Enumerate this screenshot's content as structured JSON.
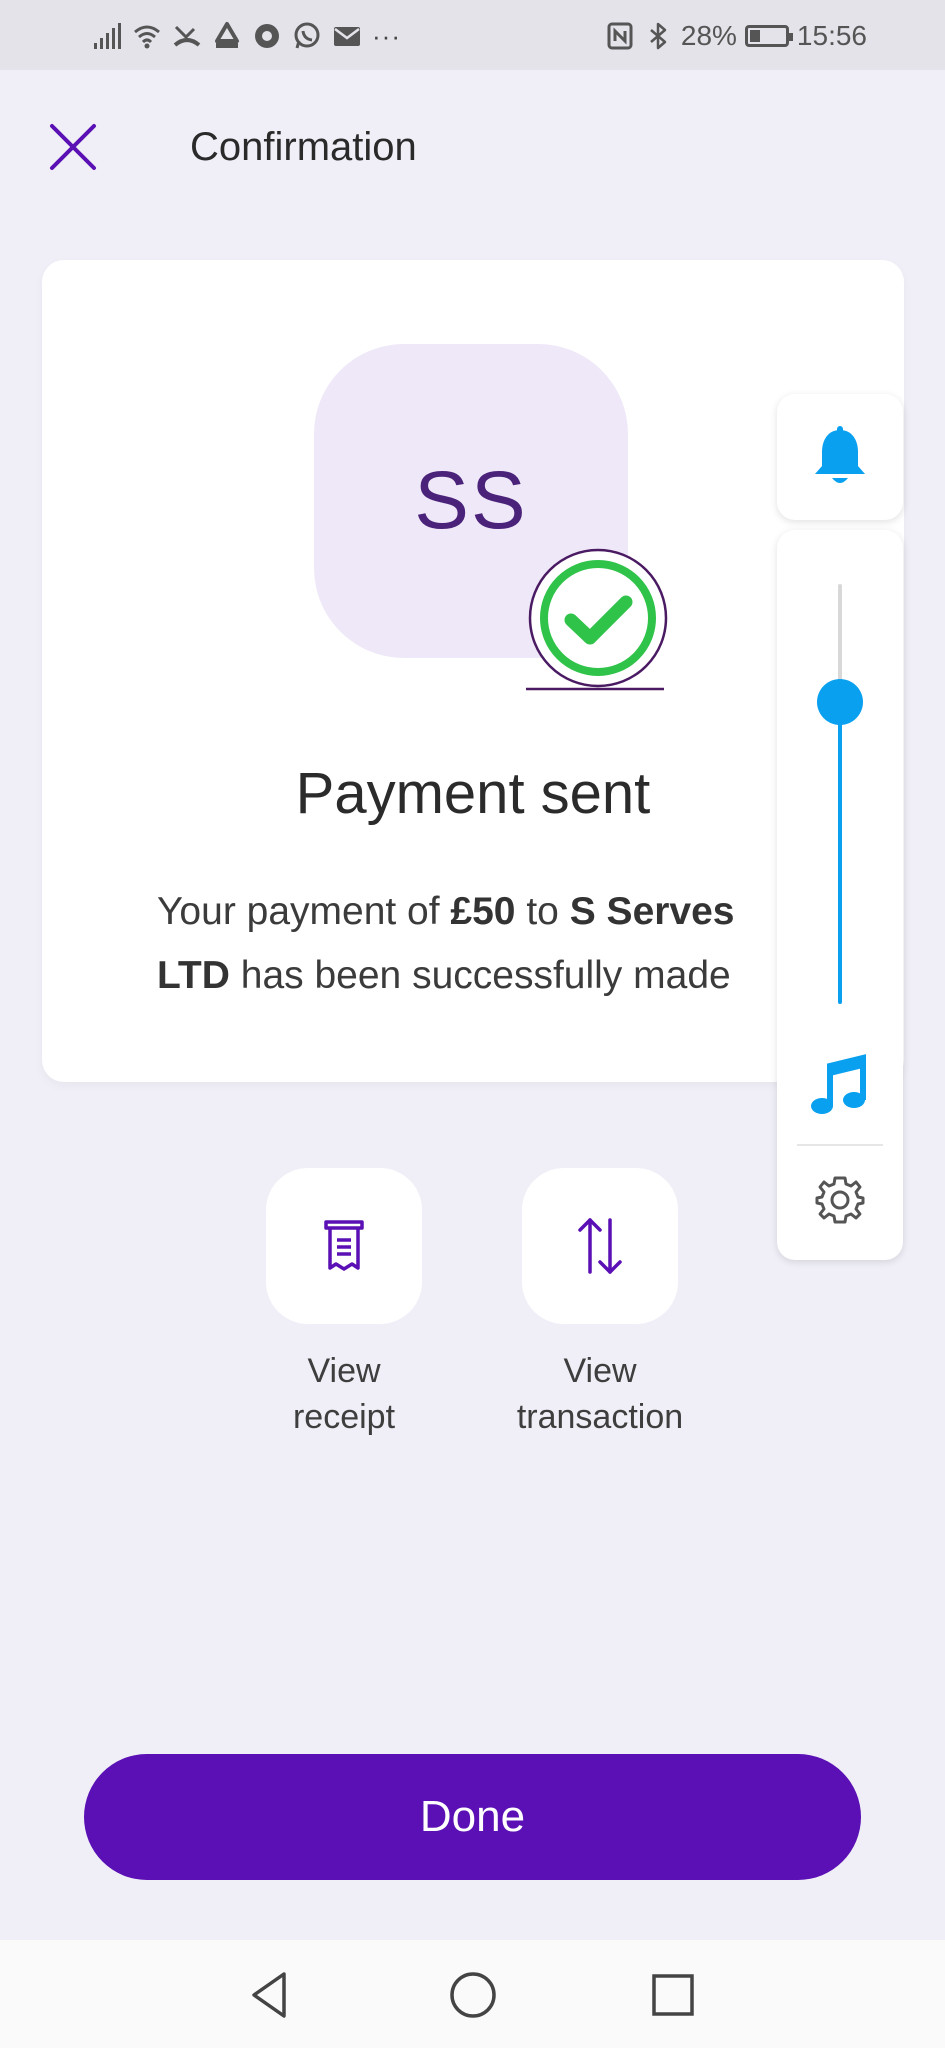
{
  "status_bar": {
    "battery": "28%",
    "battery_level": 0.28,
    "time": "15:56",
    "more": "···",
    "left_icons": [
      "signal-icon",
      "wifi-icon",
      "missed-call-icon",
      "recycle-icon",
      "chrome-icon",
      "whatsapp-icon",
      "mail-icon"
    ],
    "right_icons": [
      "nfc-icon",
      "bluetooth-icon",
      "battery-icon"
    ]
  },
  "header": {
    "title": "Confirmation",
    "close_icon": "close-icon"
  },
  "card": {
    "avatar_initials": "SS",
    "status_icon": "check-circle-icon",
    "title": "Payment sent",
    "message": {
      "prefix": "Your payment of ",
      "amount": "£50",
      "middle": " to ",
      "payee_line1": "S Serves",
      "payee_line2": "LTD",
      "suffix": " has been successfully made"
    }
  },
  "volume_panel": {
    "level": 0.72,
    "icons": [
      "bell-icon",
      "music-note-icon",
      "gear-icon"
    ],
    "accent_color": "#0aa0f0"
  },
  "actions": [
    {
      "label_line1": "View",
      "label_line2": "receipt",
      "icon": "receipt-icon"
    },
    {
      "label_line1": "View",
      "label_line2": "transaction",
      "icon": "transfer-arrows-icon"
    }
  ],
  "done_button": {
    "label": "Done",
    "color": "#5a10b4"
  },
  "nav_bar": {
    "icons": [
      "back-icon",
      "home-icon",
      "recents-icon"
    ]
  },
  "colors": {
    "brand_purple": "#5a10b4",
    "success_green": "#2fc34a",
    "background": "#f0eff7"
  }
}
